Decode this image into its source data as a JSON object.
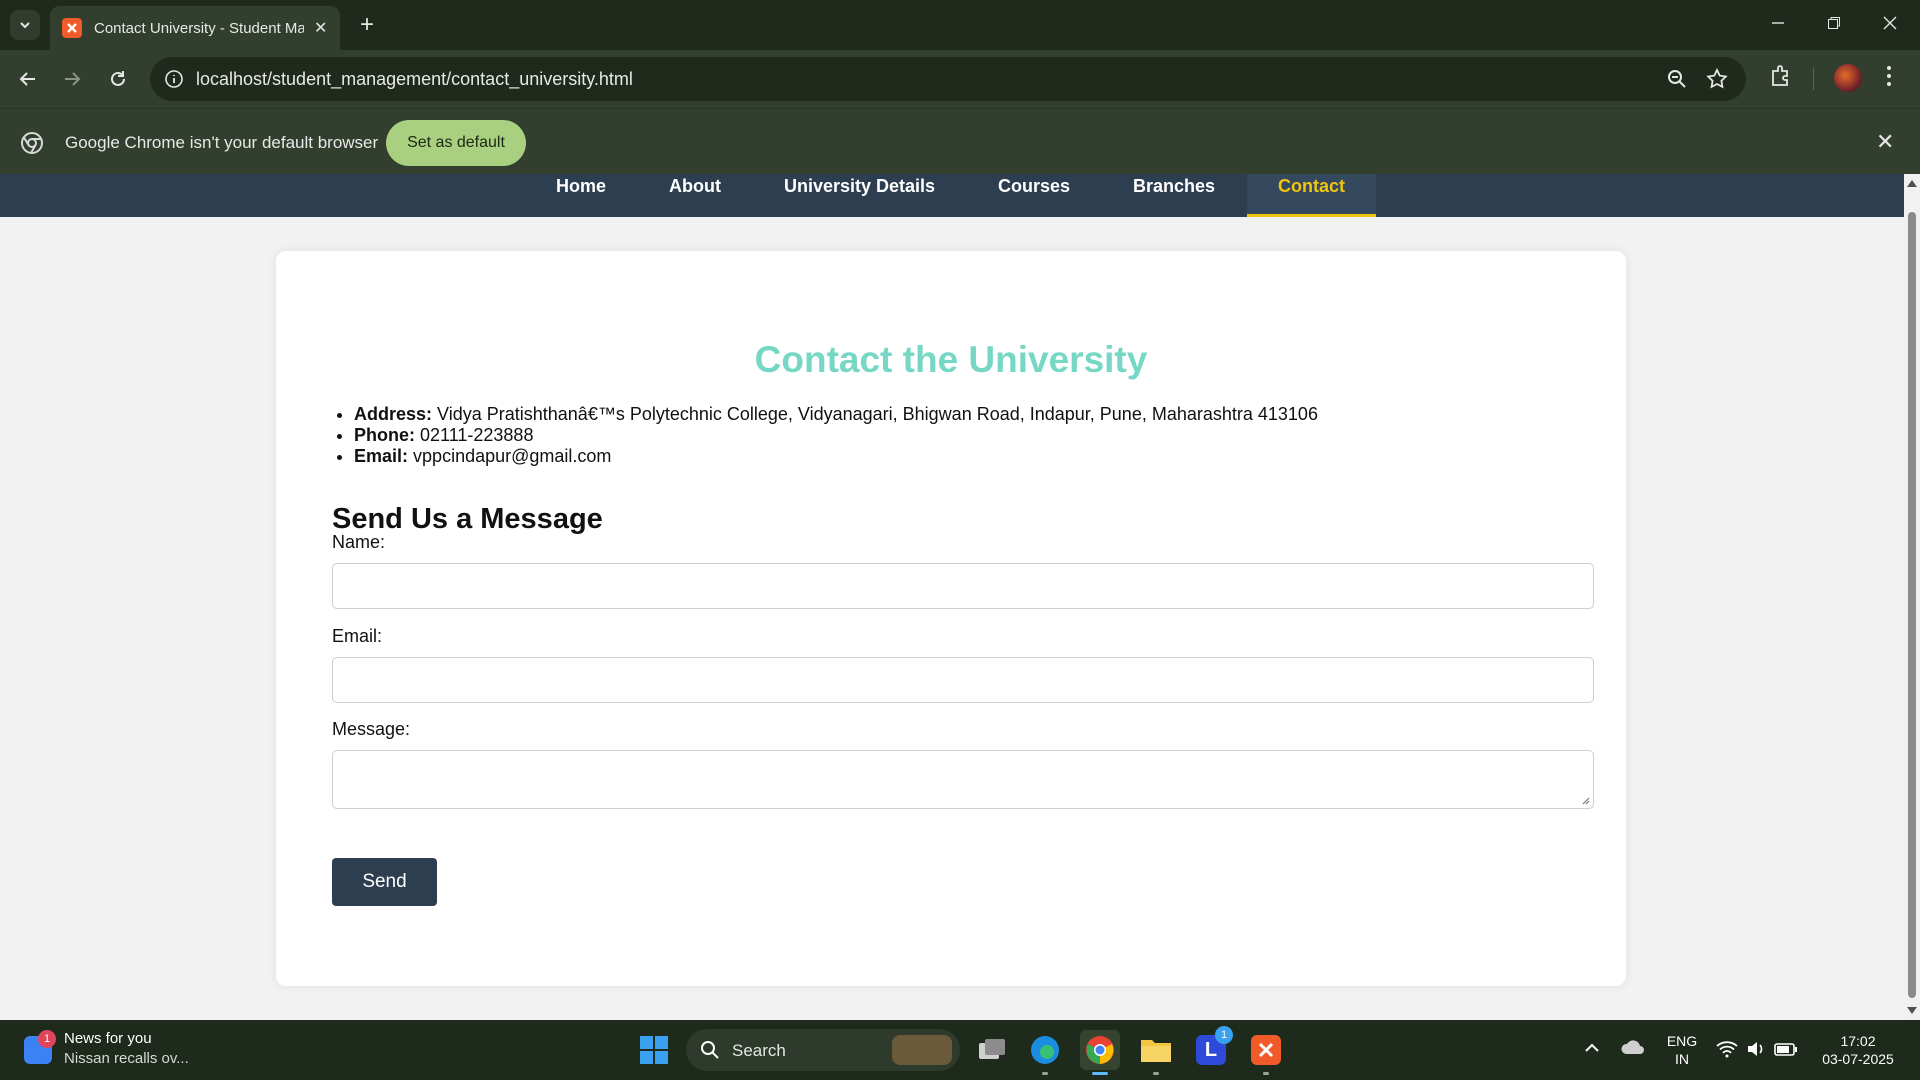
{
  "browser": {
    "tab_title": "Contact University - Student Management",
    "url": "localhost/student_management/contact_university.html",
    "infobar_text": "Google Chrome isn't your default browser",
    "infobar_button": "Set as default"
  },
  "site": {
    "nav": [
      "Home",
      "About",
      "University Details",
      "Courses",
      "Branches",
      "Contact"
    ],
    "active_nav": "Contact",
    "colors": {
      "nav_bg": "#2c3e50",
      "active": "#f1c40f",
      "heading": "#76d7c4"
    }
  },
  "contact": {
    "title": "Contact the University",
    "address_label": "Address:",
    "address": "Vidya Pratishthanâ€™s Polytechnic College, Vidyanagari, Bhigwan Road, Indapur, Pune, Maharashtra 413106",
    "phone_label": "Phone:",
    "phone": "02111-223888",
    "email_label": "Email:",
    "email": "vppcindapur@gmail.com"
  },
  "form": {
    "title": "Send Us a Message",
    "name_label": "Name:",
    "email_label": "Email:",
    "message_label": "Message:",
    "name_value": "",
    "email_value": "",
    "message_value": "",
    "send_label": "Send"
  },
  "taskbar": {
    "news_badge": "1",
    "news_title": "News for you",
    "news_sub": "Nissan recalls ov...",
    "search_label": "Search",
    "lang_line1": "ENG",
    "lang_line2": "IN",
    "time": "17:02",
    "date": "03-07-2025",
    "app_badge": "1"
  }
}
